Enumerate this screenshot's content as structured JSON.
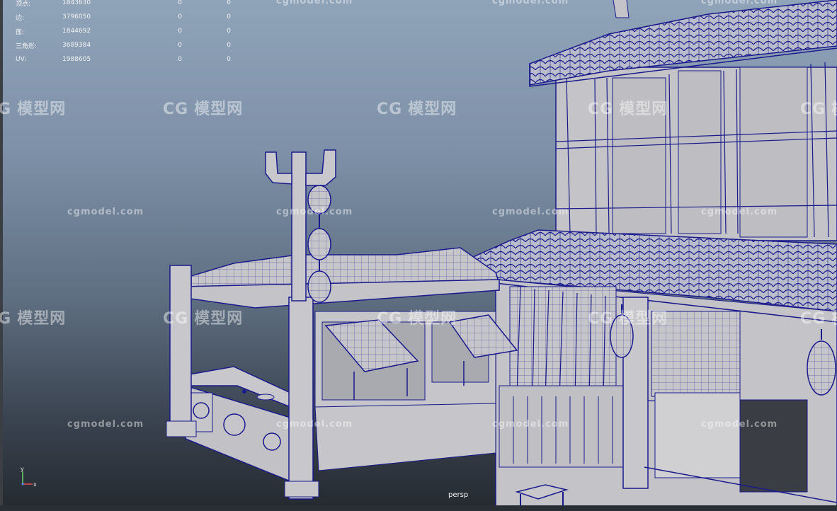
{
  "viewport": {
    "camera_label": "persp",
    "background_top": "#8fa3b9",
    "background_bottom": "#24292f",
    "wire_color": "#1a1a8c",
    "surface_color": "#c9c9cc"
  },
  "hud": {
    "rows": [
      {
        "label": "顶点:",
        "v1": "1843630",
        "v2": "0",
        "v3": "0"
      },
      {
        "label": "边:",
        "v1": "3796050",
        "v2": "0",
        "v3": "0"
      },
      {
        "label": "面:",
        "v1": "1844692",
        "v2": "0",
        "v3": "0"
      },
      {
        "label": "三角形:",
        "v1": "3689384",
        "v2": "0",
        "v3": "0"
      },
      {
        "label": "UV:",
        "v1": "1988605",
        "v2": "0",
        "v3": "0"
      }
    ]
  },
  "watermark": {
    "url": "cgmodel.com",
    "logo": "模型网",
    "logo_mark": "CG"
  },
  "axes": {
    "x": "x",
    "y": "y"
  }
}
